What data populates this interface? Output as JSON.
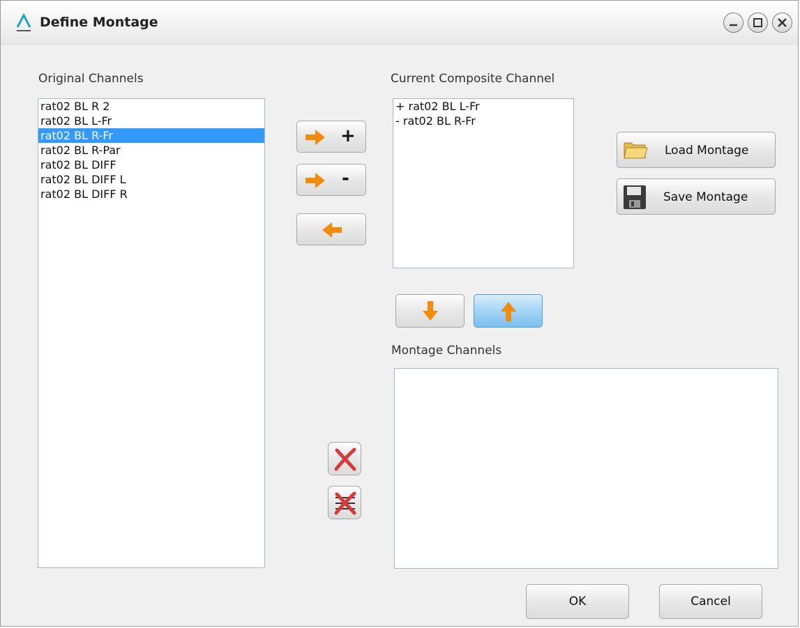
{
  "window": {
    "title": "Define Montage",
    "controls": [
      "minimize-icon",
      "maximize-icon",
      "close-icon"
    ]
  },
  "original": {
    "label": "Original Channels",
    "items": [
      "rat02 BL  R  2",
      "rat02 BL  L-Fr",
      "rat02 BL  R-Fr",
      "rat02 BL  R-Par",
      "rat02 BL   DIFF",
      "rat02 BL  DIFF L",
      "rat02 BL  DIFF R"
    ],
    "selected_index": 2
  },
  "composite": {
    "label": "Current Composite Channel",
    "items": [
      "+ rat02 BL  L-Fr",
      "- rat02 BL  R-Fr"
    ]
  },
  "montage": {
    "label": "Montage Channels",
    "items": []
  },
  "buttons": {
    "add_plus": "+",
    "add_minus": "-",
    "load_montage": "Load Montage",
    "save_montage": "Save Montage",
    "ok": "OK",
    "cancel": "Cancel"
  },
  "colors": {
    "accent_arrow": "#f28a0a",
    "selection": "#3399ff",
    "delete_red": "#d63a3a"
  }
}
